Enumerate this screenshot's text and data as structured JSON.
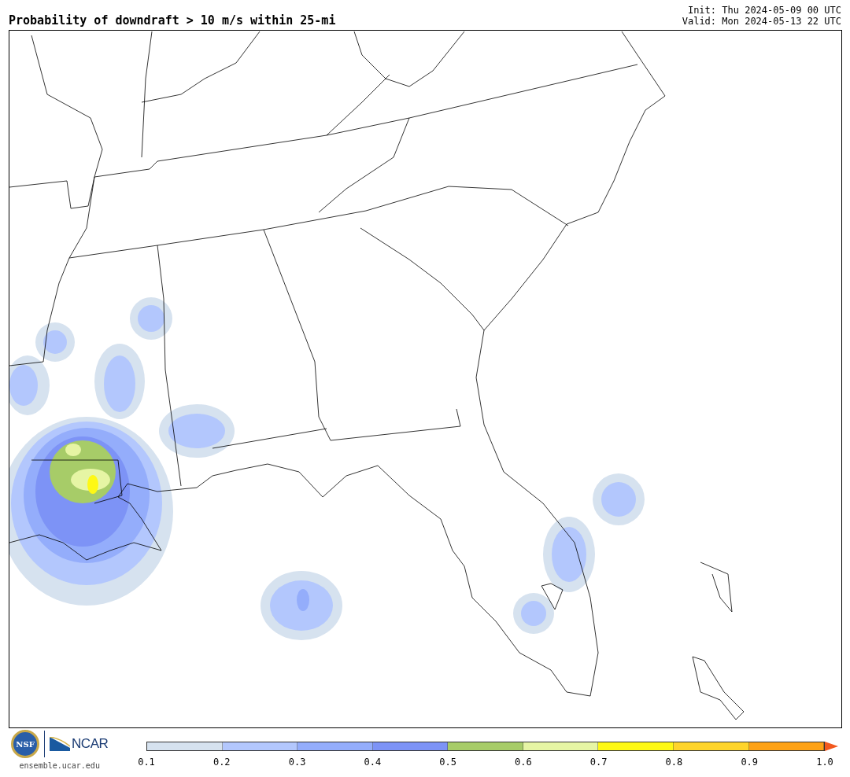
{
  "title": "Probability of downdraft > 10 m/s within 25-mi",
  "init": "Init: Thu 2024-05-09 00 UTC",
  "valid": "Valid: Mon 2024-05-13 22 UTC",
  "logos": {
    "nsf": "NSF",
    "ncar": "NCAR",
    "site": "ensemble.ucar.edu"
  },
  "colorbar": {
    "bins": [
      {
        "color": "#d6e2ef"
      },
      {
        "color": "#b3c7fd"
      },
      {
        "color": "#94adfb"
      },
      {
        "color": "#7d93f6"
      },
      {
        "color": "#a7cc68"
      },
      {
        "color": "#e6f5a4"
      },
      {
        "color": "#fef815"
      },
      {
        "color": "#fed42b"
      },
      {
        "color": "#fea216"
      }
    ],
    "overflow_arrow": {
      "color": "#f2581e"
    },
    "tick_labels": [
      "0.1",
      "0.2",
      "0.3",
      "0.4",
      "0.5",
      "0.6",
      "0.7",
      "0.8",
      "0.9",
      "1.0"
    ]
  }
}
